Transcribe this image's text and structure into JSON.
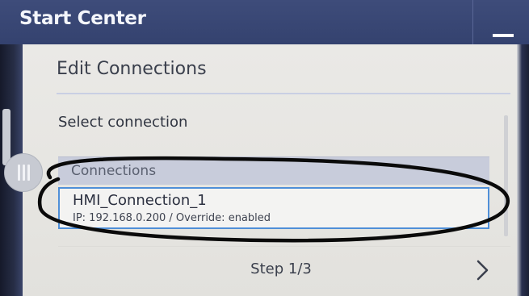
{
  "window": {
    "title": "Start Center",
    "minimize_icon": "minimize-icon"
  },
  "panel": {
    "title": "Edit Connections",
    "section_label": "Select connection",
    "list": {
      "header": "Connections",
      "items": [
        {
          "name": "HMI_Connection_1",
          "details": "IP: 192.168.0.200 / Override: enabled",
          "selected": true
        }
      ]
    },
    "footer": {
      "step": "Step 1/3",
      "next_icon": "chevron-right-icon"
    }
  },
  "colors": {
    "titlebar": "#3a4775",
    "selection_border": "#4f8fd8",
    "annotation": "#000000"
  }
}
